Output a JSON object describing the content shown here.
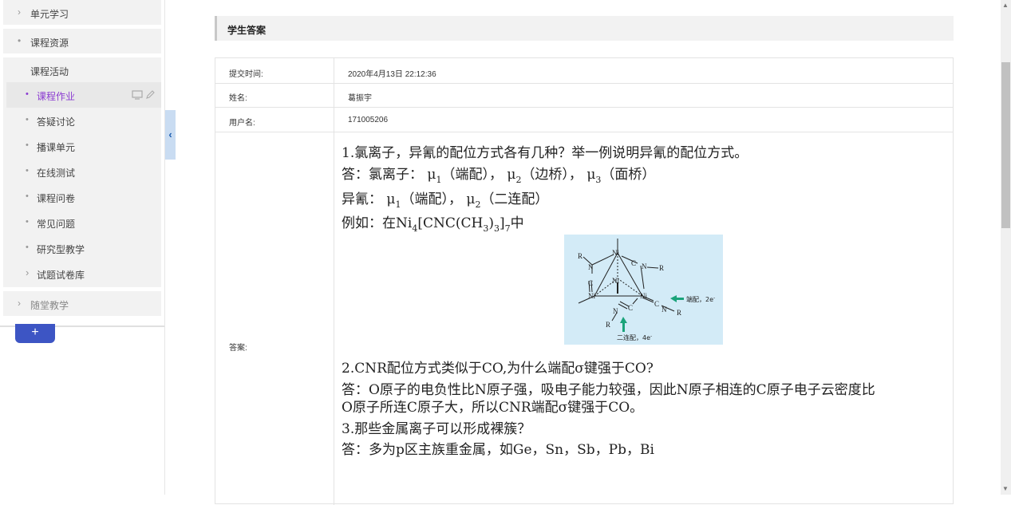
{
  "sidebar": {
    "groups": [
      {
        "label": "单元学习",
        "glyph": "›"
      },
      {
        "label": "课程资源",
        "glyph": "•"
      },
      {
        "label": "课程活动",
        "glyph": ""
      },
      {
        "label": "随堂教学",
        "glyph": "›"
      }
    ],
    "items": [
      {
        "label": "课程作业",
        "glyph": "•"
      },
      {
        "label": "答疑讨论",
        "glyph": "•"
      },
      {
        "label": "播课单元",
        "glyph": "•"
      },
      {
        "label": "在线测试",
        "glyph": "•"
      },
      {
        "label": "课程问卷",
        "glyph": "•"
      },
      {
        "label": "常见问题",
        "glyph": "•"
      },
      {
        "label": "研究型教学",
        "glyph": "•"
      },
      {
        "label": "试题试卷库",
        "glyph": "›"
      }
    ],
    "add_label": "+",
    "collapse_glyph": "‹"
  },
  "section": {
    "title": "学生答案"
  },
  "fields": [
    {
      "label": "提交时间:",
      "value": "2020年4月13日 22:12:36"
    },
    {
      "label": "姓名:",
      "value": "葛振宇"
    },
    {
      "label": "用户名:",
      "value": "171005206"
    },
    {
      "label": "答案:"
    }
  ],
  "answer": {
    "q1": "1.氯离子，异氰的配位方式各有几种？举一例说明异氰的配位方式。",
    "a1_prefix": "答：氯离子：",
    "mu": "μ",
    "sub1": "1",
    "sub2": "2",
    "sub3": "3",
    "sub4": "4",
    "sub7": "7",
    "a1_t1": "（端配），",
    "a1_t2": "（边桥），",
    "a1_t3": "（面桥）",
    "a2_prefix": "异氰：",
    "a2_t1": "（端配），",
    "a2_t2": "（二连配）",
    "ex_prefix": "例如：在Ni",
    "ex_mid": "[CNC(CH",
    "ex_mid2": ")",
    "ex_end": "]",
    "ex_tail": "中",
    "q2": "2.CNR配位方式类似于CO,为什么端配σ键强于CO?",
    "a2_line1": "答：O原子的电负性比N原子强，吸电子能力较强，因此N原子相连的C原子电子云密度比",
    "a2_line2": "O原子所连C原子大，所以CNR端配σ键强于CO。",
    "q3": "3.那些金属离子可以形成裸簇？",
    "a3": "答：多为p区主族重金属，如Ge，Sn，Sb，Pb，Bi"
  },
  "figure": {
    "atoms": {
      "ni": "Ni",
      "n": "N",
      "c": "C",
      "r": "R"
    },
    "label_terminal": "端配，2e",
    "label_bridge": "二连配，4e",
    "minus": "-",
    "arrow_color": "#1aa37a",
    "bg_color": "#d3ebf7"
  },
  "colors": {
    "accent": "#8b3bd1",
    "add_button": "#3d55c4"
  }
}
